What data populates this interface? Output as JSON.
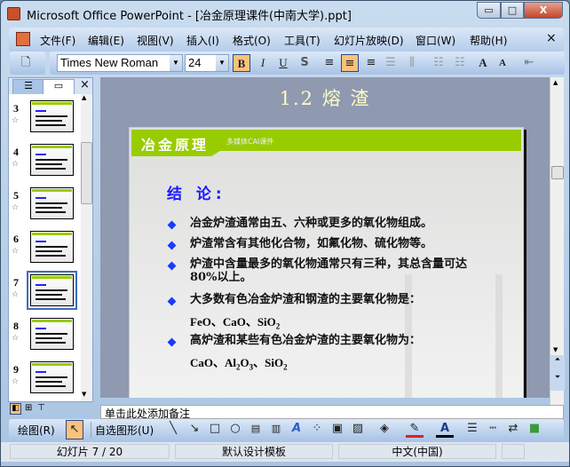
{
  "window": {
    "title": "Microsoft Office PowerPoint - [冶金原理课件(中南大学).ppt]",
    "minimize": "▭",
    "maximize": "□",
    "close": "X"
  },
  "menu": [
    "文件(F)",
    "编辑(E)",
    "视图(V)",
    "插入(I)",
    "格式(O)",
    "工具(T)",
    "幻灯片放映(D)",
    "窗口(W)",
    "帮助(H)"
  ],
  "menu_close": "×",
  "format": {
    "font": "Times New Roman",
    "size": "24",
    "bold": "B",
    "italic": "I",
    "underline": "U",
    "shadow": "S",
    "grow": "A",
    "shrink": "A"
  },
  "panel": {
    "close": "×",
    "slides": [
      {
        "num": "3"
      },
      {
        "num": "4"
      },
      {
        "num": "5"
      },
      {
        "num": "6"
      },
      {
        "num": "7",
        "selected": true
      },
      {
        "num": "8"
      },
      {
        "num": "9"
      }
    ]
  },
  "slide": {
    "section_title": "1.2 熔 渣",
    "brand": "冶金原理",
    "brand_sub": "多媒体CAI课件",
    "heading": "结 论:",
    "bullets": [
      "冶金炉渣通常由五、六种或更多的氧化物组成。",
      "炉渣常含有其他化合物，如氟化物、硫化物等。",
      "炉渣中含量最多的氧化物通常只有三种，其总含量可达80%以上。",
      "大多数有色冶金炉渣和钢渣的主要氧化物是：",
      "高炉渣和某些有色冶金炉渣的主要氧化物为："
    ],
    "formula1": {
      "a": "FeO、CaO、SiO",
      "sub": "2"
    },
    "formula2": {
      "a": "CaO、Al",
      "s1": "2",
      "b": "O",
      "s2": "3",
      "c": "、SiO",
      "s3": "2"
    }
  },
  "notes": "单击此处添加备注",
  "draw": {
    "draw_menu": "绘图(R)",
    "autoshapes": "自选图形(U)"
  },
  "status": {
    "slide": "幻灯片 7 / 20",
    "template": "默认设计模板",
    "language": "中文(中国)"
  }
}
